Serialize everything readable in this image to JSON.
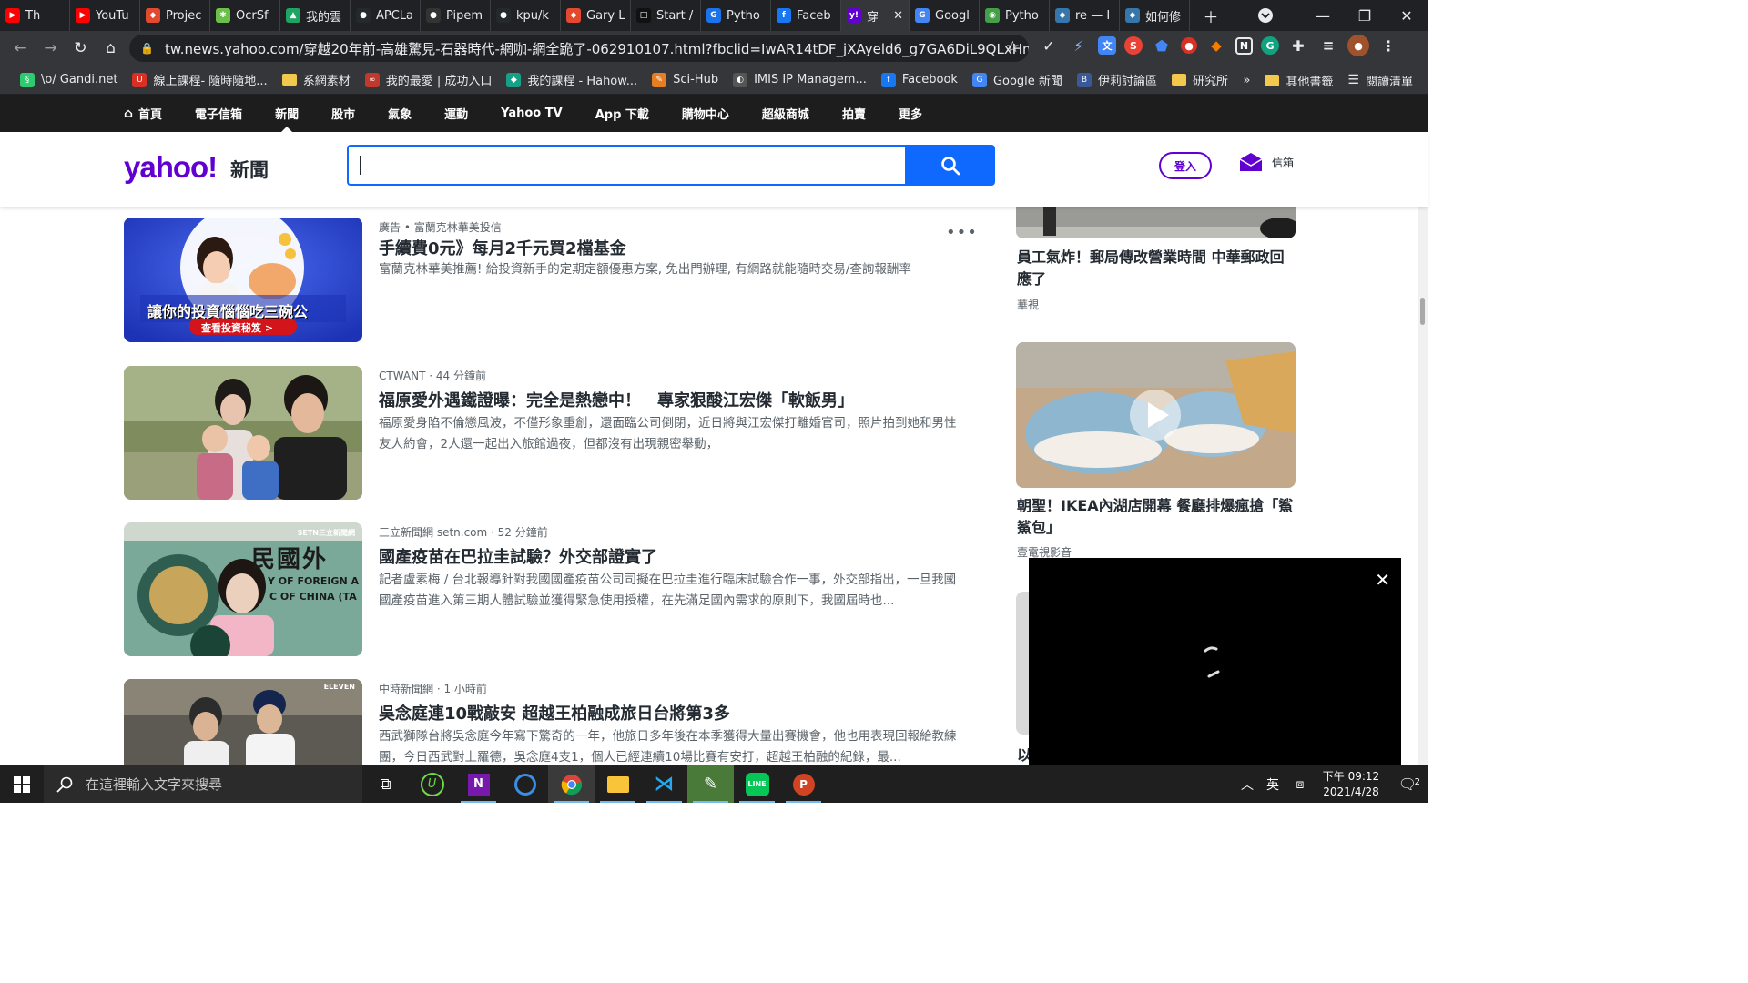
{
  "browser": {
    "tabs": [
      {
        "label": "Th",
        "color": "#ff0000",
        "glyph": "▶"
      },
      {
        "label": "YouTu",
        "color": "#ff0000",
        "glyph": "▶"
      },
      {
        "label": "Projec",
        "color": "#e2492f",
        "glyph": "◆"
      },
      {
        "label": "OcrSf",
        "color": "#6cc04a",
        "glyph": "✱"
      },
      {
        "label": "我的雲",
        "color": "#1fa463",
        "glyph": "▲"
      },
      {
        "label": "APCLa",
        "color": "#24292e",
        "glyph": "●"
      },
      {
        "label": "Pipem",
        "color": "#333333",
        "glyph": "●"
      },
      {
        "label": "kpu/k",
        "color": "#24292e",
        "glyph": "●"
      },
      {
        "label": "Gary L",
        "color": "#e2492f",
        "glyph": "◆"
      },
      {
        "label": "Start /",
        "color": "#111111",
        "glyph": "□"
      },
      {
        "label": "Pytho",
        "color": "#1a73e8",
        "glyph": "G"
      },
      {
        "label": "Faceb",
        "color": "#1877f2",
        "glyph": "f"
      },
      {
        "label": "穿",
        "color": "#6001d2",
        "glyph": "y!"
      },
      {
        "label": "Googl",
        "color": "#4285f4",
        "glyph": "G"
      },
      {
        "label": "Pytho",
        "color": "#43a047",
        "glyph": "◉"
      },
      {
        "label": "re — I",
        "color": "#3776ab",
        "glyph": "◆"
      },
      {
        "label": "如何修",
        "color": "#3776ab",
        "glyph": "◆"
      }
    ],
    "url": "tw.news.yahoo.com/穿越20年前-高雄驚見-石器時代-網咖-網全跪了-062910107.html?fbclid=IwAR14tDF_jXAyeld6_g7GA6DiL9QLxHm8N...",
    "bookmarks": [
      {
        "label": "\\o/ Gandi.net",
        "color": "#2ecc71",
        "glyph": "§"
      },
      {
        "label": "線上課程- 隨時隨地...",
        "color": "#d93025",
        "glyph": "U"
      },
      {
        "label": "系網素材",
        "folder": true
      },
      {
        "label": "我的最愛 | 成功入口",
        "color": "#c0392b",
        "glyph": "∞"
      },
      {
        "label": "我的課程 - Hahow...",
        "color": "#16a085",
        "glyph": "◆"
      },
      {
        "label": "Sci-Hub",
        "color": "#e67e22",
        "glyph": "✎"
      },
      {
        "label": "IMIS IP Managem...",
        "color": "#555555",
        "glyph": "◐"
      },
      {
        "label": "Facebook",
        "color": "#1877f2",
        "glyph": "f"
      },
      {
        "label": "Google 新聞",
        "color": "#4285f4",
        "glyph": "G"
      },
      {
        "label": "伊莉討論區",
        "color": "#3b5998",
        "glyph": "B"
      },
      {
        "label": "研究所",
        "folder": true
      }
    ],
    "bookmarks_overflow": "»",
    "other_bookmarks": "其他書籤",
    "reading_list": "閱讀清單"
  },
  "yahoo_nav": [
    {
      "label": "首頁",
      "icon": true
    },
    {
      "label": "電子信箱"
    },
    {
      "label": "新聞",
      "active": true
    },
    {
      "label": "股市"
    },
    {
      "label": "氣象"
    },
    {
      "label": "運動"
    },
    {
      "label": "Yahoo TV"
    },
    {
      "label": "App 下載"
    },
    {
      "label": "購物中心"
    },
    {
      "label": "超級商城"
    },
    {
      "label": "拍賣"
    },
    {
      "label": "更多"
    }
  ],
  "header": {
    "logo": "yahoo!",
    "logo_sub": "新聞",
    "login": "登入",
    "mail": "信箱"
  },
  "feed": [
    {
      "meta": "廣告 • 富蘭克林華美投信",
      "title": "手續費0元》每月2千元買2檔基金",
      "summary": "富蘭克林華美推薦! 給投資新手的定期定額優惠方案, 免出門辦理, 有網路就能隨時交易/查詢報酬率",
      "ad_banner": "讓你的投資惱惱吃三碗公",
      "ad_cta": "查看投資秘笈 >"
    },
    {
      "meta": "CTWANT · 44 分鐘前",
      "title": "福原愛外遇鐵證曝：完全是熱戀中！　專家狠酸江宏傑「軟飯男」",
      "summary": "福原愛身陷不倫戀風波，不僅形象重創，還面臨公司倒閉，近日將與江宏傑打離婚官司，照片拍到她和男性友人約會，2人還一起出入旅館過夜，但都沒有出現親密舉動，"
    },
    {
      "meta": "三立新聞網 setn.com · 52 分鐘前",
      "title": "國產疫苗在巴拉圭試驗？外交部證實了",
      "summary": "記者盧素梅 / 台北報導針對我國國產疫苗公司司擬在巴拉圭進行臨床試驗合作一事，外交部指出，一旦我國國產疫苗進入第三期人體試驗並獲得緊急使用授權，在先滿足國內需求的原則下，我國屆時也...",
      "badge": "SETN三立新聞網",
      "sign_text": "民國外",
      "sign_en": "Y OF FOREIGN A",
      "sign_en2": "C OF CHINA (TA"
    },
    {
      "meta": "中時新聞網 · 1 小時前",
      "title": "吳念庭連10戰敲安 超越王柏融成旅日台將第3多",
      "summary": "西武獅隊台將吳念庭今年寫下驚奇的一年，他旅日多年後在本季獲得大量出賽機會，他也用表現回報給教練團，今日西武對上羅德，吳念庭4支1，個人已經連續10場比賽有安打，超越王柏融的紀錄，最...",
      "badge": "ELEVEN"
    }
  ],
  "right": [
    {
      "title": "員工氣炸！郵局傳改營業時間 中華郵政回應了",
      "source": "華視"
    },
    {
      "title": "朝聖！IKEA內湖店開幕 餐廳排爆瘋搶「鯊鯊包」",
      "source": "壹電視影音"
    },
    {
      "title_partial": "以"
    }
  ],
  "taskbar": {
    "search_placeholder": "在這裡輸入文字來搜尋",
    "ime": "英",
    "time": "下午 09:12",
    "date": "2021/4/28",
    "notif_count": "2"
  }
}
